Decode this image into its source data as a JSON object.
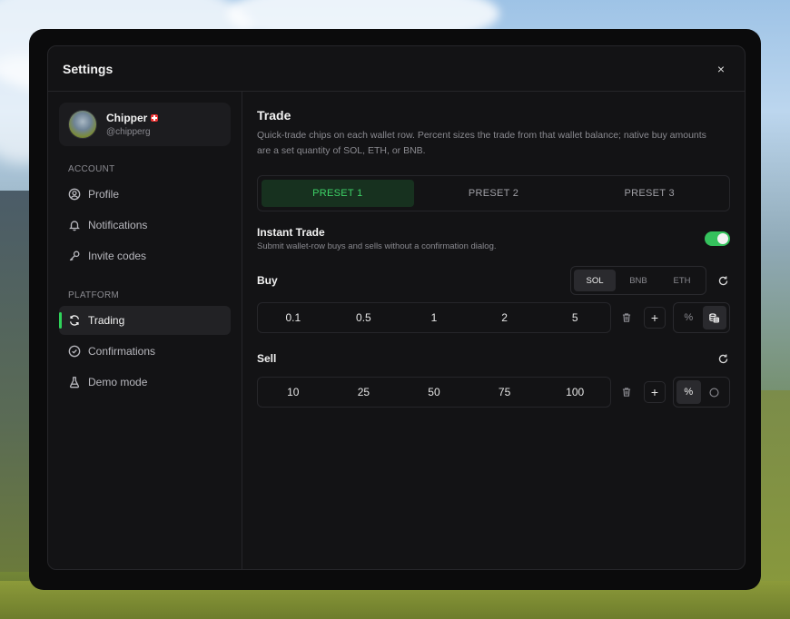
{
  "modal": {
    "title": "Settings",
    "close_label": "×"
  },
  "user": {
    "name": "Chipper",
    "handle": "@chipperg"
  },
  "sidebar": {
    "sections": [
      {
        "label": "ACCOUNT",
        "items": [
          "Profile",
          "Notifications",
          "Invite codes"
        ]
      },
      {
        "label": "PLATFORM",
        "items": [
          "Trading",
          "Confirmations",
          "Demo mode"
        ]
      }
    ],
    "active_item": "Trading"
  },
  "trade": {
    "title": "Trade",
    "description": "Quick-trade chips on each wallet row. Percent sizes the trade from that wallet balance; native buy amounts are a set quantity of SOL, ETH, or BNB.",
    "presets": [
      "PRESET 1",
      "PRESET 2",
      "PRESET 3"
    ],
    "active_preset": "PRESET 1",
    "instant": {
      "title": "Instant Trade",
      "description": "Submit wallet-row buys and sells without a confirmation dialog.",
      "enabled": true
    },
    "buy": {
      "label": "Buy",
      "currencies": [
        "SOL",
        "BNB",
        "ETH"
      ],
      "active_currency": "SOL",
      "values": [
        "0.1",
        "0.5",
        "1",
        "2",
        "5"
      ],
      "mode_percent": "%",
      "active_mode": "native"
    },
    "sell": {
      "label": "Sell",
      "values": [
        "10",
        "25",
        "50",
        "75",
        "100"
      ],
      "mode_percent": "%",
      "active_mode": "percent"
    }
  },
  "colors": {
    "accent": "#3ed267",
    "toggle_on": "#35c25d",
    "panel": "#131315"
  }
}
